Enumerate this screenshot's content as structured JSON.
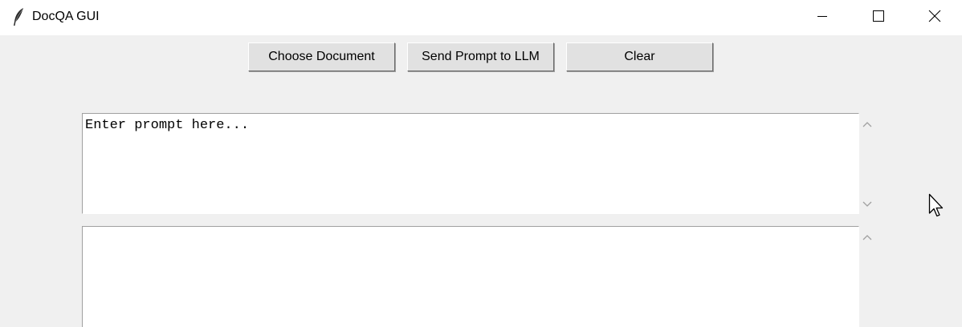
{
  "window": {
    "title": "DocQA GUI"
  },
  "toolbar": {
    "choose_document_label": "Choose Document",
    "send_prompt_label": "Send Prompt to LLM",
    "clear_label": "Clear"
  },
  "prompt": {
    "value": "Enter prompt here..."
  },
  "response": {
    "value": ""
  },
  "icons": {
    "app": "feather-icon",
    "minimize": "minimize-icon",
    "maximize": "maximize-icon",
    "close": "close-icon",
    "scroll_up": "chevron-up-icon",
    "scroll_down": "chevron-down-icon",
    "cursor": "mouse-pointer-icon"
  }
}
